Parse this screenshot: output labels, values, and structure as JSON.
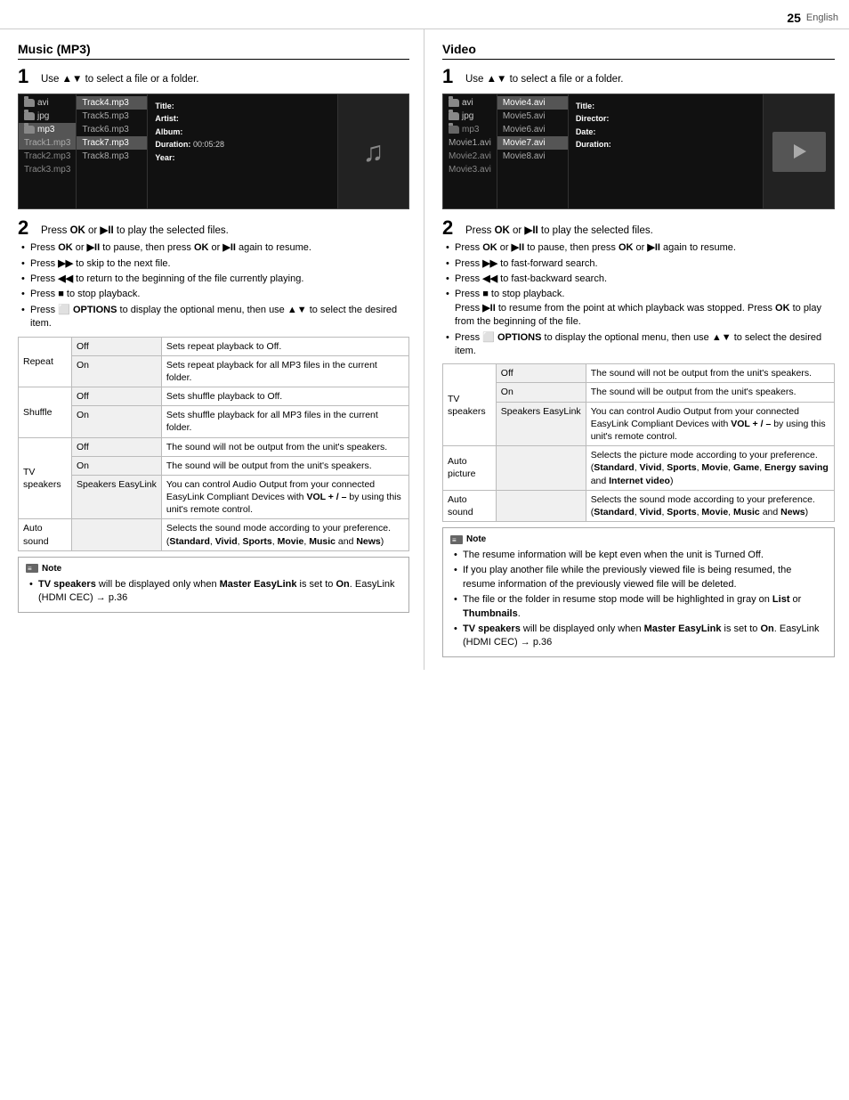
{
  "page": {
    "number": "25",
    "language": "English"
  },
  "music": {
    "title": "Music (MP3)",
    "step1_text": "Use ▲▼ to select a file or a folder.",
    "step2_intro": "Press OK or ▶II to play the selected files.",
    "bullets": [
      "Press OK or ▶II to pause, then press OK or ▶II again to resume.",
      "Press ▶▶ to skip to the next file.",
      "Press ◀◀ to return to the beginning of the file currently playing.",
      "Press ■ to stop playback.",
      "Press ⬜ OPTIONS to display the optional menu, then use ▲▼ to select the desired item."
    ],
    "file_browser": {
      "col1": [
        "avi",
        "jpg",
        "mp3"
      ],
      "col2": [
        "Track1.mp3",
        "Track2.mp3",
        "Track3.mp3"
      ],
      "col3": [
        "Track4.mp3",
        "Track5.mp3",
        "Track6.mp3",
        "Track7.mp3",
        "Track8.mp3"
      ],
      "info": {
        "title_label": "Title:",
        "artist_label": "Artist:",
        "album_label": "Album:",
        "duration_label": "Duration:",
        "duration_val": "00:05:28",
        "year_label": "Year:"
      }
    },
    "table": {
      "rows": [
        {
          "label": "Repeat",
          "options": [
            {
              "name": "Off",
              "desc": "Sets repeat playback to Off."
            },
            {
              "name": "On",
              "desc": "Sets repeat playback for all MP3 files in the current folder."
            }
          ]
        },
        {
          "label": "Shuffle",
          "options": [
            {
              "name": "Off",
              "desc": "Sets shuffle playback to Off."
            },
            {
              "name": "On",
              "desc": "Sets shuffle playback for all MP3 files in the current folder."
            }
          ]
        },
        {
          "label": "TV speakers",
          "options": [
            {
              "name": "Off",
              "desc": "The sound will not be output from the unit's speakers."
            },
            {
              "name": "On",
              "desc": "The sound will be output from the unit's speakers."
            },
            {
              "name": "Speakers EasyLink",
              "desc": "You can control Audio Output from your connected EasyLink Compliant Devices with VOL + / – by using this unit's remote control."
            }
          ]
        },
        {
          "label": "Auto sound",
          "options": [
            {
              "name": "",
              "desc": "Selects the sound mode according to your preference. (Standard, Vivid, Sports, Movie, Music and News)"
            }
          ]
        }
      ]
    },
    "note": {
      "header": "Note",
      "bullets": [
        "TV speakers will be displayed only when Master EasyLink is set to On. EasyLink (HDMI CEC) → p.36"
      ]
    }
  },
  "video": {
    "title": "Video",
    "step1_text": "Use ▲▼ to select a file or a folder.",
    "step2_intro": "Press OK or ▶II to play the selected files.",
    "bullets": [
      "Press OK or ▶II to pause, then press OK or ▶II again to resume.",
      "Press ▶▶ to fast-forward search.",
      "Press ◀◀ to fast-backward search.",
      "Press ■ to stop playback. Press ▶II to resume from the point at which playback was stopped. Press OK to play from the beginning of the file.",
      "Press ⬜ OPTIONS to display the optional menu, then use ▲▼ to select the desired item."
    ],
    "file_browser": {
      "col1": [
        "avi",
        "jpg",
        "mp3"
      ],
      "col2": [
        "Movie1.avi",
        "Movie2.avi",
        "Movie3.avi"
      ],
      "col3": [
        "Movie4.avi",
        "Movie5.avi",
        "Movie6.avi",
        "Movie7.avi",
        "Movie8.avi"
      ],
      "info": {
        "title_label": "Title:",
        "director_label": "Director:",
        "date_label": "Date:",
        "duration_label": "Duration:"
      }
    },
    "table": {
      "rows": [
        {
          "label": "TV speakers",
          "options": [
            {
              "name": "Off",
              "desc": "The sound will not be output from the unit's speakers."
            },
            {
              "name": "On",
              "desc": "The sound will be output from the unit's speakers."
            },
            {
              "name": "Speakers EasyLink",
              "desc": "You can control Audio Output from your connected EasyLink Compliant Devices with VOL + / – by using this unit's remote control."
            }
          ]
        },
        {
          "label": "Auto picture",
          "options": [
            {
              "name": "",
              "desc": "Selects the picture mode according to your preference. (Standard, Vivid, Sports, Movie, Game, Energy saving and Internet video)"
            }
          ]
        },
        {
          "label": "Auto sound",
          "options": [
            {
              "name": "",
              "desc": "Selects the sound mode according to your preference. (Standard, Vivid, Sports, Movie, Music and News)"
            }
          ]
        }
      ]
    },
    "note": {
      "header": "Note",
      "bullets": [
        "The resume information will be kept even when the unit is Turned Off.",
        "If you play another file while the previously viewed file is being resumed, the resume information of the previously viewed file will be deleted.",
        "The file or the folder in resume stop mode will be highlighted in gray on List or Thumbnails.",
        "TV speakers will be displayed only when Master EasyLink is set to On. EasyLink (HDMI CEC) → p.36"
      ]
    }
  }
}
